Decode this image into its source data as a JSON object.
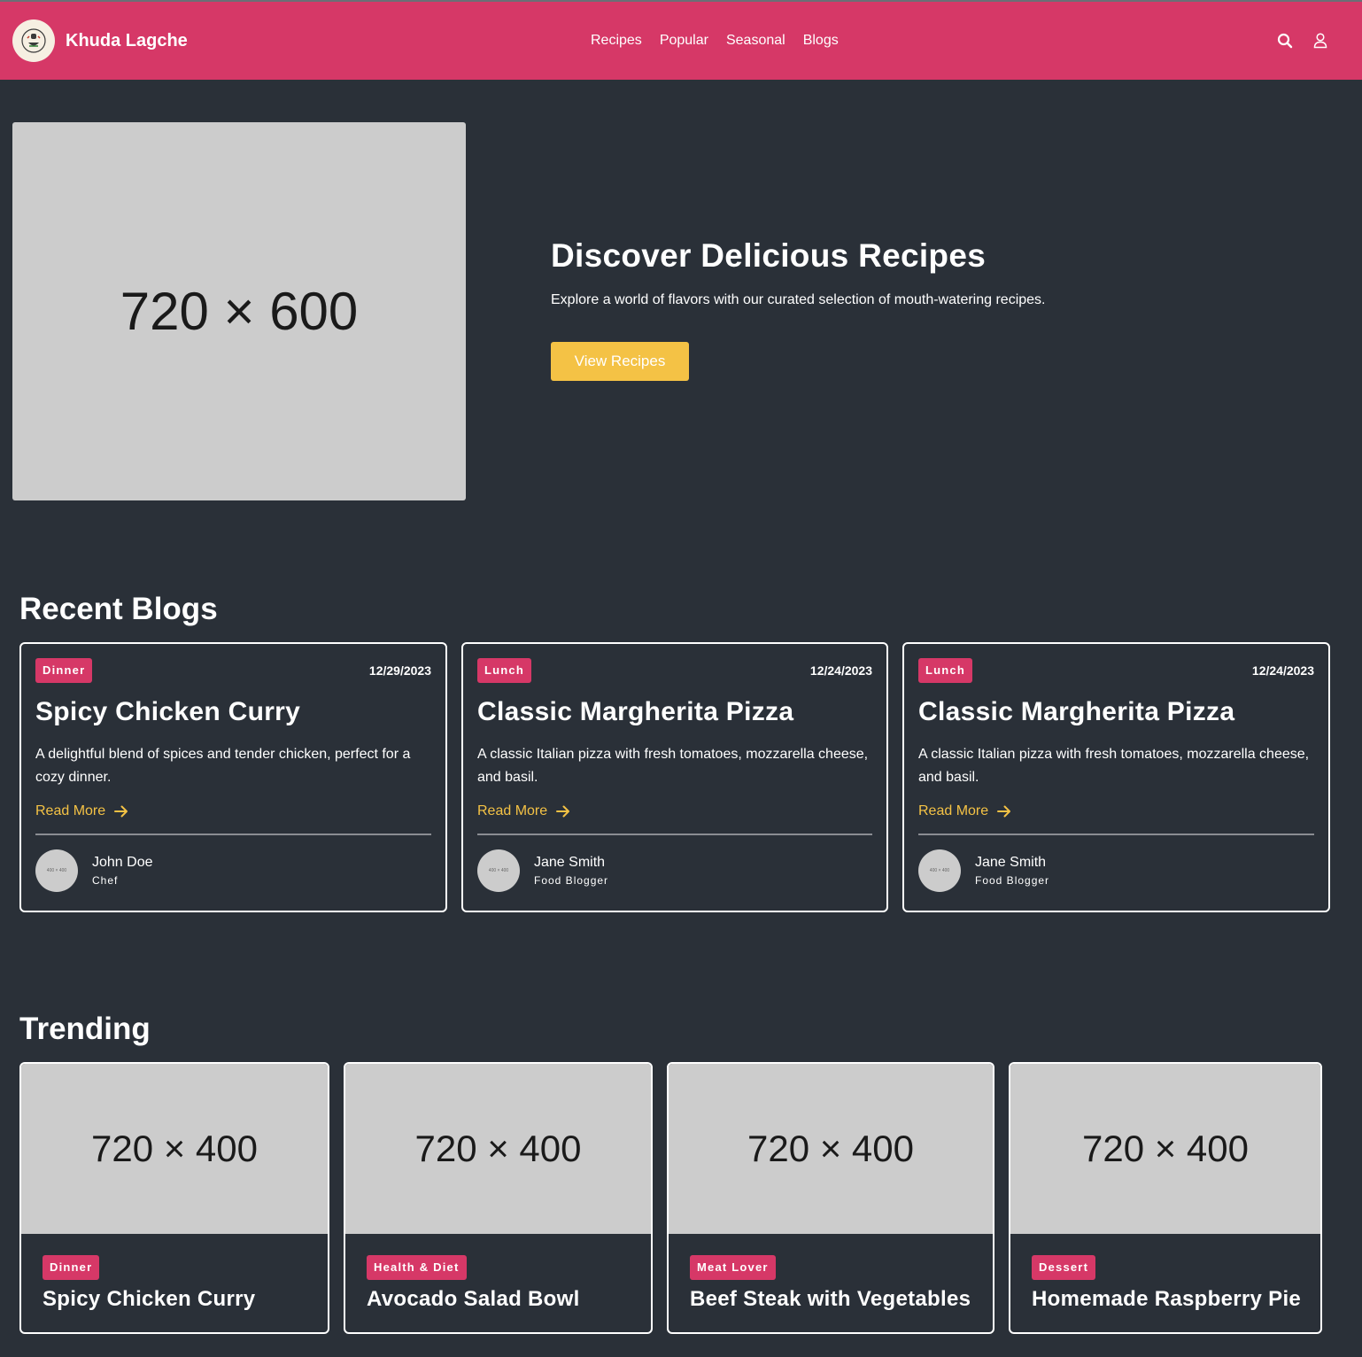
{
  "header": {
    "brand": "Khuda Lagche",
    "nav": [
      "Recipes",
      "Popular",
      "Seasonal",
      "Blogs"
    ]
  },
  "hero": {
    "image_placeholder": "720 × 600",
    "title": "Discover Delicious Recipes",
    "subtitle": "Explore a world of flavors with our curated selection of mouth-watering recipes.",
    "button": "View Recipes"
  },
  "recent_blogs": {
    "heading": "Recent Blogs",
    "items": [
      {
        "tag": "Dinner",
        "date": "12/29/2023",
        "title": "Spicy Chicken Curry",
        "description": "A delightful blend of spices and tender chicken, perfect for a cozy dinner.",
        "read_more": "Read More",
        "author": "John Doe",
        "role": "Chef",
        "avatar_placeholder": "400 × 400"
      },
      {
        "tag": "Lunch",
        "date": "12/24/2023",
        "title": "Classic Margherita Pizza",
        "description": "A classic Italian pizza with fresh tomatoes, mozzarella cheese, and basil.",
        "read_more": "Read More",
        "author": "Jane Smith",
        "role": "Food Blogger",
        "avatar_placeholder": "400 × 400"
      },
      {
        "tag": "Lunch",
        "date": "12/24/2023",
        "title": "Classic Margherita Pizza",
        "description": "A classic Italian pizza with fresh tomatoes, mozzarella cheese, and basil.",
        "read_more": "Read More",
        "author": "Jane Smith",
        "role": "Food Blogger",
        "avatar_placeholder": "400 × 400"
      }
    ]
  },
  "trending": {
    "heading": "Trending",
    "items": [
      {
        "image_placeholder": "720 × 400",
        "tag": "Dinner",
        "title": "Spicy Chicken Curry"
      },
      {
        "image_placeholder": "720 × 400",
        "tag": "Health & Diet",
        "title": "Avocado Salad Bowl"
      },
      {
        "image_placeholder": "720 × 400",
        "tag": "Meat Lover",
        "title": "Beef Steak with Vegetables"
      },
      {
        "image_placeholder": "720 × 400",
        "tag": "Dessert",
        "title": "Homemade Raspberry Pie"
      }
    ]
  },
  "icons": {
    "search": "search-icon",
    "user": "user-icon",
    "arrow": "arrow-right-icon",
    "logo": "logo-icon"
  },
  "colors": {
    "navbar": "#d63867",
    "background": "#2a3038",
    "accent": "#f4c245",
    "tag": "#d63867",
    "placeholder": "#cccccc"
  }
}
